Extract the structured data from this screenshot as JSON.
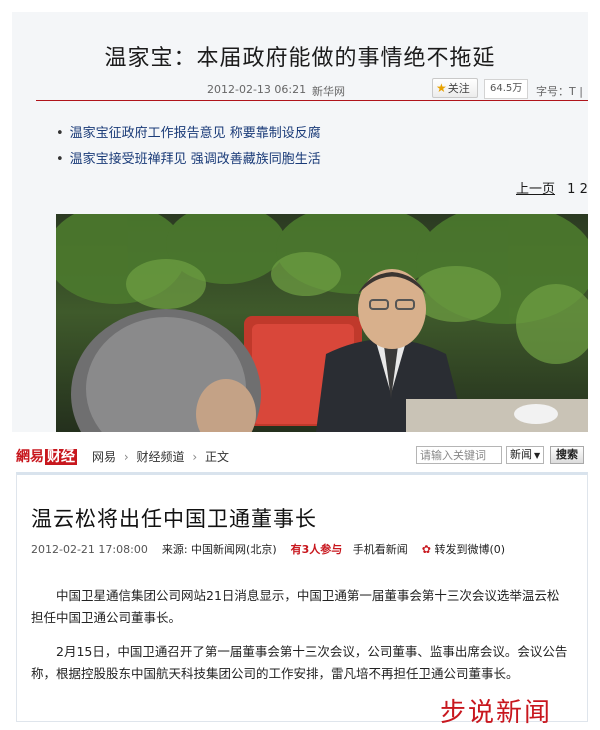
{
  "top_article": {
    "title": "温家宝：本届政府能做的事情绝不拖延",
    "date": "2012-02-13 06:21",
    "source": "新华网",
    "follow_label": "关注",
    "follow_count": "64.5万",
    "font_size_label": "字号：T |",
    "related_links": [
      "温家宝征政府工作报告意见 称要靠制设反腐",
      "温家宝接受班禅拜见 强调改善藏族同胞生活"
    ],
    "pager": {
      "prev": "上一页",
      "page1": "1",
      "page2": "2"
    },
    "photo_icon": "photo-meeting"
  },
  "site": {
    "logo_wy": "網易",
    "logo_cj": "财经",
    "breadcrumb": [
      "网易",
      "财经频道",
      "正文"
    ],
    "search_placeholder": "请输入关键词",
    "search_scope": "新闻",
    "search_button": "搜索"
  },
  "bottom_article": {
    "title": "温云松将出任中国卫通董事长",
    "datetime": "2012-02-21 17:08:00",
    "source_label": "来源: 中国新闻网(北京)",
    "participants": "有3人参与",
    "mobile": "手机看新闻",
    "weibo": "转发到微博(0)",
    "paragraphs": [
      "中国卫星通信集团公司网站21日消息显示，中国卫通第一届董事会第十三次会议选举温云松担任中国卫通公司董事长。",
      "2月15日，中国卫通召开了第一届董事会第十三次会议，公司董事、监事出席会议。会议公告称，根据控股股东中国航天科技集团公司的工作安排，雷凡培不再担任卫通公司董事长。"
    ]
  },
  "watermark": "步说新闻"
}
